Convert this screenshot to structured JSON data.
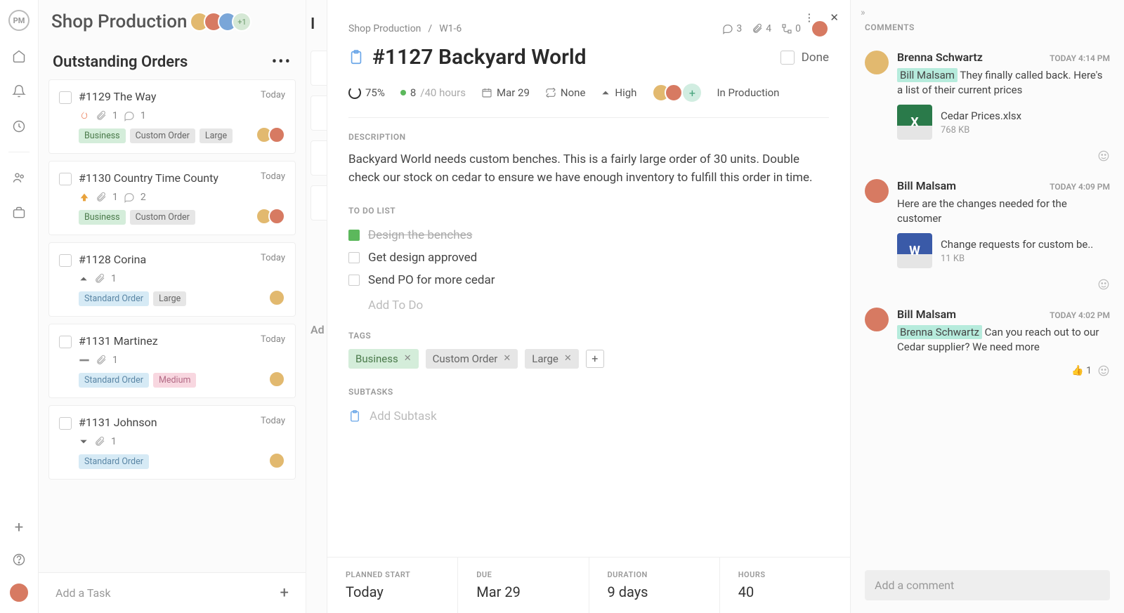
{
  "app": {
    "logo_text": "PM"
  },
  "board": {
    "title": "Shop Production",
    "column_title": "Outstanding Orders",
    "add_task": "Add a Task",
    "avatar_more": "+1"
  },
  "next_column": {
    "initial": "I",
    "add_text": "Ad"
  },
  "cards": [
    {
      "title": "#1129 The Way",
      "date": "Today",
      "attach": "1",
      "comments": "1",
      "tags": [
        {
          "label": "Business",
          "cls": "tag-green"
        },
        {
          "label": "Custom Order",
          "cls": "tag-gray"
        },
        {
          "label": "Large",
          "cls": "tag-gray"
        }
      ],
      "priority": "fire"
    },
    {
      "title": "#1130 Country Time County",
      "date": "Today",
      "attach": "1",
      "comments": "2",
      "tags": [
        {
          "label": "Business",
          "cls": "tag-green"
        },
        {
          "label": "Custom Order",
          "cls": "tag-gray"
        }
      ],
      "priority": "up"
    },
    {
      "title": "#1128 Corina",
      "date": "Today",
      "attach": "1",
      "comments": "",
      "tags": [
        {
          "label": "Standard Order",
          "cls": "tag-blue"
        },
        {
          "label": "Large",
          "cls": "tag-gray"
        }
      ],
      "priority": "flat-up"
    },
    {
      "title": "#1131 Martinez",
      "date": "Today",
      "attach": "1",
      "comments": "",
      "tags": [
        {
          "label": "Standard Order",
          "cls": "tag-blue"
        },
        {
          "label": "Medium",
          "cls": "tag-pink"
        }
      ],
      "priority": "flat"
    },
    {
      "title": "#1131 Johnson",
      "date": "Today",
      "attach": "1",
      "comments": "",
      "tags": [
        {
          "label": "Standard Order",
          "cls": "tag-blue"
        }
      ],
      "priority": "down"
    }
  ],
  "detail": {
    "crumb_project": "Shop Production",
    "crumb_id": "W1-6",
    "stats": {
      "comments": "3",
      "attachments": "4",
      "subtasks": "0"
    },
    "title": "#1127 Backyard World",
    "done_label": "Done",
    "progress": "75%",
    "hours_done": "8",
    "hours_total": "/40 hours",
    "due": "Mar 29",
    "repeat": "None",
    "priority": "High",
    "status": "In Production",
    "description_label": "DESCRIPTION",
    "description": "Backyard World needs custom benches. This is a fairly large order of 30 units. Double check our stock on cedar to ensure we have enough inventory to fulfill this order in time.",
    "todo_label": "TO DO LIST",
    "todos": [
      {
        "text": "Design the benches",
        "done": true
      },
      {
        "text": "Get design approved",
        "done": false
      },
      {
        "text": "Send PO for more cedar",
        "done": false
      }
    ],
    "add_todo": "Add To Do",
    "tags_label": "TAGS",
    "tags": [
      {
        "label": "Business",
        "cls": "green"
      },
      {
        "label": "Custom Order",
        "cls": "gray"
      },
      {
        "label": "Large",
        "cls": "gray"
      }
    ],
    "subtasks_label": "SUBTASKS",
    "add_subtask": "Add Subtask",
    "planned": [
      {
        "label": "PLANNED START",
        "value": "Today"
      },
      {
        "label": "DUE",
        "value": "Mar 29"
      },
      {
        "label": "DURATION",
        "value": "9 days"
      },
      {
        "label": "HOURS",
        "value": "40"
      }
    ]
  },
  "comments": {
    "header": "COMMENTS",
    "input_placeholder": "Add a comment",
    "list": [
      {
        "author": "Brenna Schwartz",
        "time": "TODAY 4:14 PM",
        "mention": "Bill Malsam",
        "text": " They finally called back. Here's a list of their current prices",
        "attach": {
          "kind": "xl",
          "icon": "X",
          "name": "Cedar Prices.xlsx",
          "size": "768 KB"
        },
        "reactions": {}
      },
      {
        "author": "Bill Malsam",
        "time": "TODAY 4:09 PM",
        "text": "Here are the changes needed for the customer",
        "attach": {
          "kind": "doc",
          "icon": "W",
          "name": "Change requests for custom be..",
          "size": "11 KB"
        },
        "reactions": {}
      },
      {
        "author": "Bill Malsam",
        "time": "TODAY 4:02 PM",
        "mention": "Brenna Schwartz",
        "text": " Can you reach out to our Cedar supplier? We need more",
        "reactions": {
          "thumbs": "1"
        }
      }
    ]
  }
}
